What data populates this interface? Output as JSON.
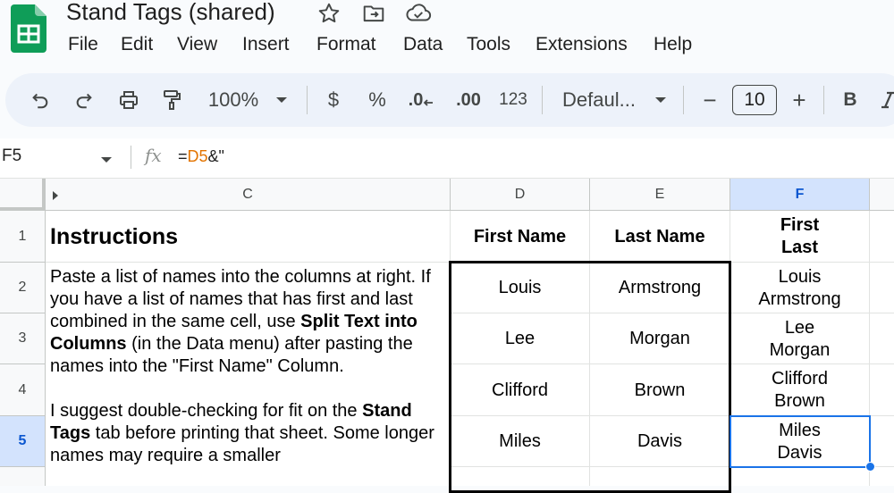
{
  "app": {
    "title": "Stand Tags (shared)",
    "menu": [
      "File",
      "Edit",
      "View",
      "Insert",
      "Format",
      "Data",
      "Tools",
      "Extensions",
      "Help"
    ]
  },
  "toolbar": {
    "zoom": "100%",
    "currency": "$",
    "percent": "%",
    "decrease_decimals": ".0",
    "increase_decimals": ".00",
    "number_format": "123",
    "font": "Defaul...",
    "font_minus": "−",
    "font_size": "10",
    "font_plus": "+",
    "bold": "B"
  },
  "formula_bar": {
    "cell_ref": "F5",
    "fx": "fx",
    "formula_eq": "=",
    "formula_ref": "D5",
    "formula_rest": "&\""
  },
  "columns": [
    "C",
    "D",
    "E",
    "F"
  ],
  "rows": [
    "1",
    "2",
    "3",
    "4",
    "5"
  ],
  "cells": {
    "c1": "Instructions",
    "d1": "First Name",
    "e1": "Last Name",
    "f1_line1": "First",
    "f1_line2": "Last",
    "instructions": {
      "p1a": "Paste a list of names into the columns at right. If you have a list of names that has first and last combined in the same cell, use ",
      "p1b": "Split Text into Columns",
      "p1c": " (in the Data menu) after pasting the names into the \"First Name\" Column.",
      "p2a": "I suggest double-checking for fit on the ",
      "p2b": "Stand Tags",
      "p2c": " tab before printing that sheet. Some longer names may require a smaller"
    },
    "names": [
      {
        "first": "Louis",
        "last": "Armstrong"
      },
      {
        "first": "Lee",
        "last": "Morgan"
      },
      {
        "first": "Clifford",
        "last": "Brown"
      },
      {
        "first": "Miles",
        "last": "Davis"
      }
    ]
  },
  "colors": {
    "logo_green": "#0f9d58",
    "selection_blue": "#1a73e8",
    "selected_header": "#d3e3fd",
    "formula_ref": "#e37400"
  }
}
